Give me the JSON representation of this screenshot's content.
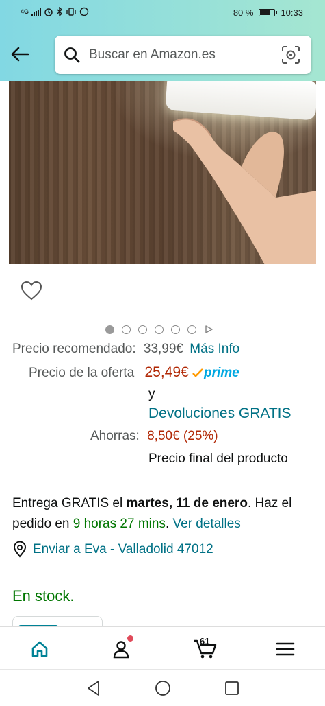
{
  "status_bar": {
    "network": "4G",
    "battery": "80 %",
    "battery_level": 0.8,
    "time": "10:33"
  },
  "header": {
    "back_icon": "arrow-left-icon",
    "search": {
      "placeholder": "Buscar en Amazon.es",
      "icon": "search-icon",
      "camera_icon": "camera-scan-icon"
    }
  },
  "gallery": {
    "image_count": 6,
    "active_index": 0
  },
  "pricing": {
    "recommended_label": "Precio recomendado:",
    "recommended_price": "33,99€",
    "more_info": "Más Info",
    "offer_label": "Precio de la oferta",
    "offer_price": "25,49€",
    "prime": "prime",
    "and": "y",
    "returns": "Devoluciones GRATIS",
    "savings_label": "Ahorras:",
    "savings_value": "8,50€ (25%)",
    "final_note": "Precio final del producto"
  },
  "delivery": {
    "prefix": "Entrega GRATIS el ",
    "date": "martes, 11 de enero",
    "suffix": ". Haz el",
    "order_prefix": "pedido en ",
    "time_left": "9 horas 27 mins",
    "period": ". ",
    "details_link": "Ver detalles",
    "ship_to": "Enviar a Eva - Valladolid 47012"
  },
  "stock": "En stock.",
  "bottom_nav": {
    "cart_count": "61"
  },
  "colors": {
    "header_gradient_start": "#82d8e3",
    "header_gradient_end": "#a5e6d1",
    "link": "#007185",
    "price": "#b12704",
    "green": "#007600",
    "prime_blue": "#00a8e1",
    "teal": "#008296"
  }
}
